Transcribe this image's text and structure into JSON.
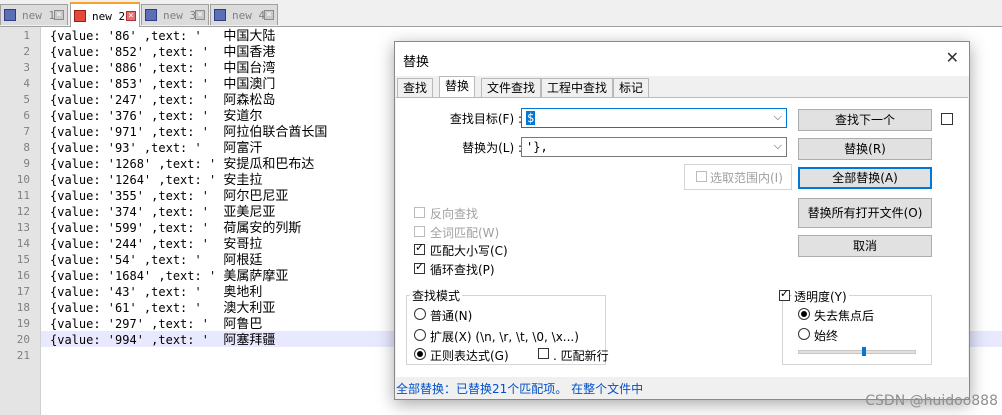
{
  "tabs": [
    {
      "label": "new 1",
      "active": false
    },
    {
      "label": "new 2",
      "active": true
    },
    {
      "label": "new 3",
      "active": false
    },
    {
      "label": "new 4",
      "active": false
    }
  ],
  "editor": {
    "line_numbers": [
      "1",
      "2",
      "3",
      "4",
      "5",
      "6",
      "7",
      "8",
      "9",
      "10",
      "11",
      "12",
      "13",
      "14",
      "15",
      "16",
      "17",
      "18",
      "19",
      "20",
      "21"
    ],
    "lines": [
      {
        "code": "{value: '86' ,text: '   ",
        "text": "中国大陆"
      },
      {
        "code": "{value: '852' ,text: '  ",
        "text": "中国香港"
      },
      {
        "code": "{value: '886' ,text: '  ",
        "text": "中国台湾"
      },
      {
        "code": "{value: '853' ,text: '  ",
        "text": "中国澳门"
      },
      {
        "code": "{value: '247' ,text: '  ",
        "text": "阿森松岛"
      },
      {
        "code": "{value: '376' ,text: '  ",
        "text": "安道尔"
      },
      {
        "code": "{value: '971' ,text: '  ",
        "text": "阿拉伯联合酋长国"
      },
      {
        "code": "{value: '93' ,text: '   ",
        "text": "阿富汗"
      },
      {
        "code": "{value: '1268' ,text: ' ",
        "text": "安提瓜和巴布达"
      },
      {
        "code": "{value: '1264' ,text: ' ",
        "text": "安圭拉"
      },
      {
        "code": "{value: '355' ,text: '  ",
        "text": "阿尔巴尼亚"
      },
      {
        "code": "{value: '374' ,text: '  ",
        "text": "亚美尼亚"
      },
      {
        "code": "{value: '599' ,text: '  ",
        "text": "荷属安的列斯"
      },
      {
        "code": "{value: '244' ,text: '  ",
        "text": "安哥拉"
      },
      {
        "code": "{value: '54' ,text: '   ",
        "text": "阿根廷"
      },
      {
        "code": "{value: '1684' ,text: ' ",
        "text": "美属萨摩亚"
      },
      {
        "code": "{value: '43' ,text: '   ",
        "text": "奥地利"
      },
      {
        "code": "{value: '61' ,text: '   ",
        "text": "澳大利亚"
      },
      {
        "code": "{value: '297' ,text: '  ",
        "text": "阿鲁巴"
      },
      {
        "code": "{value: '994' ,text: '  ",
        "text": "阿塞拜疆"
      }
    ]
  },
  "dialog": {
    "title": "替换",
    "close": "✕",
    "tabs": [
      "查找",
      "替换",
      "文件查找",
      "工程中查找",
      "标记"
    ],
    "find_label": "查找目标(F) :",
    "find_value": "$",
    "replace_label": "替换为(L) :",
    "replace_value": "'},",
    "in_selection": "选取范围内(I)",
    "find_next": "查找下一个",
    "replace": "替换(R)",
    "replace_all": "全部替换(A)",
    "replace_all_open": "替换所有打开文件(O)",
    "cancel": "取消",
    "options": {
      "backward": "反向查找",
      "whole_word": "全词匹配(W)",
      "match_case": "匹配大小写(C)",
      "wrap": "循环查找(P)"
    },
    "mode": {
      "title": "查找模式",
      "normal": "普通(N)",
      "extended": "扩展(X) (\\n, \\r, \\t, \\0, \\x...)",
      "regex": "正则表达式(G)",
      "dot_newline": ". 匹配新行"
    },
    "transparency": {
      "title": "透明度(Y)",
      "on_lose_focus": "失去焦点后",
      "always": "始终",
      "level": 0.55
    },
    "status": "全部替换：已替换21个匹配项。 在整个文件中"
  },
  "watermark": "CSDN @huidoo888"
}
